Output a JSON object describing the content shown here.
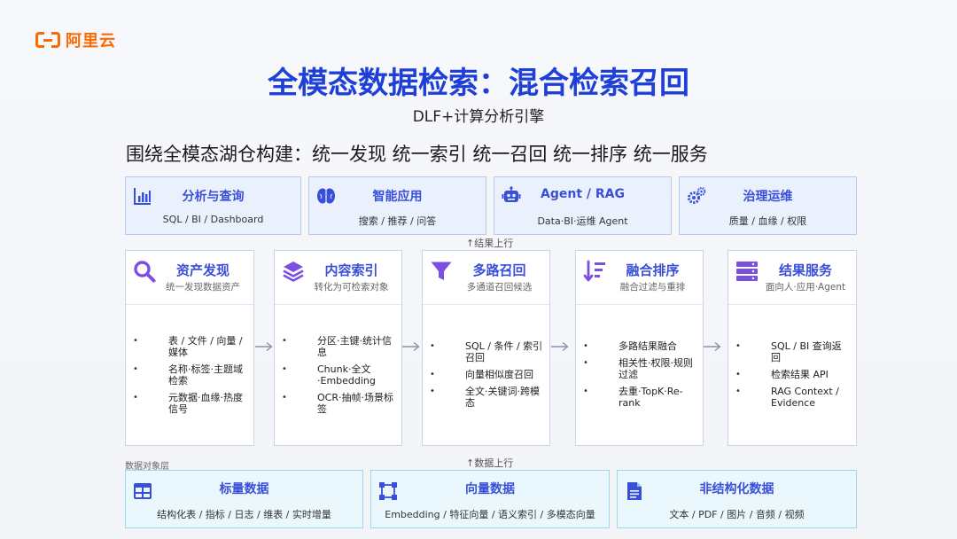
{
  "logo": {
    "text": "阿里云"
  },
  "title": "全模态数据检索：混合检索召回",
  "subtitle": "DLF+计算分析引擎",
  "headline": "围绕全模态湖仓构建：统一发现  统一索引  统一召回  统一排序  统一服务",
  "top_cards": [
    {
      "title": "分析与查询",
      "subtitle": "SQL / BI / Dashboard",
      "icon": "bar-chart-icon"
    },
    {
      "title": "智能应用",
      "subtitle": "搜索 / 推荐 / 问答",
      "icon": "brain-icon"
    },
    {
      "title": "Agent / RAG",
      "subtitle": "Data·BI·运维 Agent",
      "icon": "robot-icon"
    },
    {
      "title": "治理运维",
      "subtitle": "质量 / 血缘 / 权限",
      "icon": "gears-icon"
    }
  ],
  "flow_top": "↑结果上行",
  "flow_bottom": "↑数据上行",
  "mid_cards": [
    {
      "title": "资产发现",
      "subtitle": "统一发现数据资产",
      "icon": "search-icon",
      "items": [
        "表 / 文件 / 向量 / 媒体",
        "名称·标签·主题域检索",
        "元数据·血缘·热度信号"
      ]
    },
    {
      "title": "内容索引",
      "subtitle": "转化为可检索对象",
      "icon": "layers-icon",
      "items": [
        "分区·主键·统计信息",
        "Chunk·全文·Embedding",
        "OCR·抽帧·场景标签"
      ]
    },
    {
      "title": "多路召回",
      "subtitle": "多通道召回候选",
      "icon": "funnel-icon",
      "items": [
        "SQL / 条件 / 索引召回",
        "向量相似度召回",
        "全文·关键词·跨模态"
      ]
    },
    {
      "title": "融合排序",
      "subtitle": "融合过滤与重排",
      "icon": "sort-icon",
      "items": [
        "多路结果融合",
        "相关性·权限·规则过滤",
        "去重·TopK·Re-rank"
      ]
    },
    {
      "title": "结果服务",
      "subtitle": "面向人·应用·Agent",
      "icon": "server-icon",
      "items": [
        "SQL / BI 查询返回",
        "检索结果 API",
        "RAG Context / Evidence"
      ]
    }
  ],
  "layer_label": "数据对象层",
  "bottom_cards": [
    {
      "title": "标量数据",
      "subtitle": "结构化表 / 指标 / 日志 / 维表 / 实时增量",
      "icon": "table-icon"
    },
    {
      "title": "向量数据",
      "subtitle": "Embedding / 特征向量 / 语义索引 / 多模态向量",
      "icon": "vector-icon"
    },
    {
      "title": "非结构化数据",
      "subtitle": "文本 / PDF / 图片 / 音频 / 视频",
      "icon": "document-icon"
    }
  ],
  "colors": {
    "accent": "#3a4fd8",
    "title": "#1f3fd9",
    "icon_purple": "#7b4fe0",
    "brand": "#ff6a00"
  }
}
